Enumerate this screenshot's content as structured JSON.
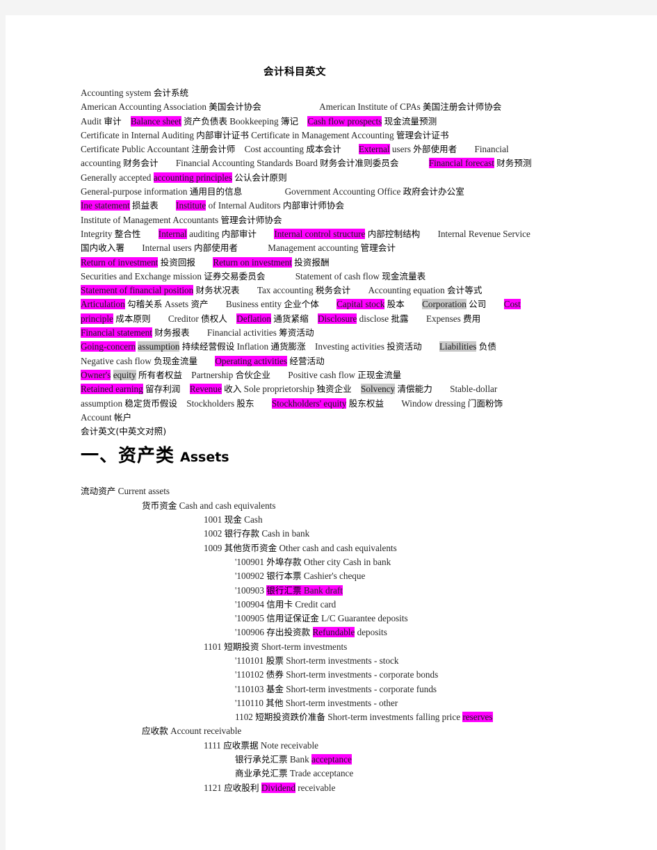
{
  "document": {
    "title": "会计科目英文",
    "subtitle_line": "会计英文(中英文对照)",
    "section_heading": {
      "cn": "一、资产类",
      "en": "Assets"
    }
  },
  "glossary_lines": [
    {
      "id": "line-1",
      "parts": [
        {
          "t": "Accounting  system",
          "k": "en"
        },
        {
          "t": "会计系统",
          "k": "cn"
        }
      ]
    },
    {
      "id": "line-2",
      "parts": [
        {
          "t": "American  Accounting  Association",
          "k": "en"
        },
        {
          "t": "美国会计协会",
          "k": "cn"
        },
        {
          "t": "__sp5__",
          "k": "sp"
        },
        {
          "t": "American  Institute  of  CPAs",
          "k": "en"
        },
        {
          "t": "美国注册会计师协会",
          "k": "cn"
        }
      ]
    },
    {
      "id": "line-3",
      "parts": [
        {
          "t": "Audit",
          "k": "en"
        },
        {
          "t": "审计",
          "k": "cn"
        },
        {
          "t": "__sp1__",
          "k": "sp"
        },
        {
          "t": "Balance  sheet",
          "k": "en",
          "hl": "pink"
        },
        {
          "t": "资产负债表",
          "k": "cn"
        },
        {
          "t": "Bookkeeping",
          "k": "en"
        },
        {
          "t": "簿记",
          "k": "cn"
        },
        {
          "t": "__sp1__",
          "k": "sp"
        },
        {
          "t": "Cash  flow  prospects",
          "k": "en",
          "hl": "pink"
        },
        {
          "t": "现金流量预测",
          "k": "cn"
        }
      ]
    },
    {
      "id": "line-4",
      "parts": [
        {
          "t": "Certificate  in  Internal  Auditing",
          "k": "en"
        },
        {
          "t": "内部审计证书",
          "k": "cn"
        },
        {
          "t": "Certificate  in  Management  Accounting",
          "k": "en"
        },
        {
          "t": "管理会计证书",
          "k": "cn"
        }
      ]
    },
    {
      "id": "line-5",
      "parts": [
        {
          "t": "Certificate  Public  Accountant",
          "k": "en"
        },
        {
          "t": "注册会计师",
          "k": "cn"
        },
        {
          "t": "__sp1__",
          "k": "sp"
        },
        {
          "t": "Cost  accounting",
          "k": "en"
        },
        {
          "t": "成本会计",
          "k": "cn"
        },
        {
          "t": "__sp2__",
          "k": "sp"
        },
        {
          "t": "External",
          "k": "en",
          "hl": "pink"
        },
        {
          "t": "users",
          "k": "en"
        },
        {
          "t": "外部使用者",
          "k": "cn"
        },
        {
          "t": "__sp2__",
          "k": "sp"
        },
        {
          "t": "Financial",
          "k": "en"
        }
      ]
    },
    {
      "id": "line-6",
      "parts": [
        {
          "t": "accounting",
          "k": "en"
        },
        {
          "t": "财务会计",
          "k": "cn"
        },
        {
          "t": "__sp2__",
          "k": "sp"
        },
        {
          "t": "Financial  Accounting  Standards  Board",
          "k": "en"
        },
        {
          "t": "财务会计准则委员会",
          "k": "cn"
        },
        {
          "t": "__sp3__",
          "k": "sp"
        },
        {
          "t": "Financial  forecast",
          "k": "en",
          "hl": "pink"
        },
        {
          "t": "财务预测",
          "k": "cn"
        }
      ]
    },
    {
      "id": "line-7",
      "parts": [
        {
          "t": "Generally  accepted",
          "k": "en"
        },
        {
          "t": "accounting  principles",
          "k": "en",
          "hl": "pink"
        },
        {
          "t": "公认会计原则",
          "k": "cn"
        }
      ]
    },
    {
      "id": "line-8",
      "parts": [
        {
          "t": "General-purpose  information",
          "k": "en"
        },
        {
          "t": "通用目的信息",
          "k": "cn"
        },
        {
          "t": "__sp4__",
          "k": "sp"
        },
        {
          "t": "Government  Accounting  Office",
          "k": "en"
        },
        {
          "t": "政府会计办公室",
          "k": "cn"
        }
      ]
    },
    {
      "id": "line-9",
      "parts": [
        {
          "t": "Ine  statement",
          "k": "en",
          "hl": "pink"
        },
        {
          "t": "损益表",
          "k": "cn"
        },
        {
          "t": "__sp2__",
          "k": "sp"
        },
        {
          "t": "Institute",
          "k": "en",
          "hl": "pink"
        },
        {
          "t": "of  Internal  Auditors",
          "k": "en"
        },
        {
          "t": "内部审计师协会",
          "k": "cn"
        }
      ]
    },
    {
      "id": "line-10",
      "parts": [
        {
          "t": "Institute  of  Management  Accountants",
          "k": "en"
        },
        {
          "t": "管理会计师协会",
          "k": "cn"
        }
      ]
    },
    {
      "id": "line-11",
      "parts": [
        {
          "t": "Integrity",
          "k": "en"
        },
        {
          "t": "整合性",
          "k": "cn"
        },
        {
          "t": "__sp2__",
          "k": "sp"
        },
        {
          "t": "Internal",
          "k": "en",
          "hl": "pink"
        },
        {
          "t": "auditing",
          "k": "en"
        },
        {
          "t": "内部审计",
          "k": "cn"
        },
        {
          "t": "__sp2__",
          "k": "sp"
        },
        {
          "t": "Internal  control  structure",
          "k": "en",
          "hl": "pink"
        },
        {
          "t": "内部控制结构",
          "k": "cn"
        },
        {
          "t": "__sp2__",
          "k": "sp"
        },
        {
          "t": "Internal  Revenue  Service",
          "k": "en"
        }
      ]
    },
    {
      "id": "line-12",
      "parts": [
        {
          "t": "国内收入署",
          "k": "cn"
        },
        {
          "t": "__sp2__",
          "k": "sp"
        },
        {
          "t": "Internal  users",
          "k": "en"
        },
        {
          "t": "内部使用者",
          "k": "cn"
        },
        {
          "t": "__sp3__",
          "k": "sp"
        },
        {
          "t": "Management  accounting",
          "k": "en"
        },
        {
          "t": "管理会计",
          "k": "cn"
        }
      ]
    },
    {
      "id": "line-13",
      "parts": [
        {
          "t": "Return  of  investment",
          "k": "en",
          "hl": "pink"
        },
        {
          "t": "投资回报",
          "k": "cn"
        },
        {
          "t": "__sp2__",
          "k": "sp"
        },
        {
          "t": "Return  on  investment",
          "k": "en",
          "hl": "pink"
        },
        {
          "t": "投资报酬",
          "k": "cn"
        }
      ]
    },
    {
      "id": "line-14",
      "parts": [
        {
          "t": "Securities  and  Exchange  mission",
          "k": "en"
        },
        {
          "t": "证券交易委员会",
          "k": "cn"
        },
        {
          "t": "__sp3__",
          "k": "sp"
        },
        {
          "t": "Statement  of  cash  flow",
          "k": "en"
        },
        {
          "t": "现金流量表",
          "k": "cn"
        }
      ]
    },
    {
      "id": "line-15",
      "parts": [
        {
          "t": "Statement  of  financial  position",
          "k": "en",
          "hl": "pink"
        },
        {
          "t": "财务状况表",
          "k": "cn"
        },
        {
          "t": "__sp2__",
          "k": "sp"
        },
        {
          "t": "Tax  accounting",
          "k": "en"
        },
        {
          "t": "税务会计",
          "k": "cn"
        },
        {
          "t": "__sp2__",
          "k": "sp"
        },
        {
          "t": "Accounting  equation",
          "k": "en"
        },
        {
          "t": "会计等式",
          "k": "cn"
        }
      ]
    },
    {
      "id": "line-16",
      "parts": [
        {
          "t": "Articulation",
          "k": "en",
          "hl": "pink"
        },
        {
          "t": "勾稽关系",
          "k": "cn"
        },
        {
          "t": "Assets",
          "k": "en"
        },
        {
          "t": "资产",
          "k": "cn"
        },
        {
          "t": "__sp2__",
          "k": "sp"
        },
        {
          "t": "Business  entity",
          "k": "en"
        },
        {
          "t": "企业个体",
          "k": "cn"
        },
        {
          "t": "__sp2__",
          "k": "sp"
        },
        {
          "t": "Capital  stock",
          "k": "en",
          "hl": "pink"
        },
        {
          "t": "股本",
          "k": "cn"
        },
        {
          "t": "__sp2__",
          "k": "sp"
        },
        {
          "t": "Corporation",
          "k": "en",
          "hl": "gray"
        },
        {
          "t": "公司",
          "k": "cn"
        },
        {
          "t": "__sp2__",
          "k": "sp"
        },
        {
          "t": "Cost",
          "k": "en",
          "hl": "pink"
        }
      ]
    },
    {
      "id": "line-17",
      "parts": [
        {
          "t": "principle",
          "k": "en",
          "hl": "pink"
        },
        {
          "t": "成本原则",
          "k": "cn"
        },
        {
          "t": "__sp2__",
          "k": "sp"
        },
        {
          "t": "Creditor",
          "k": "en"
        },
        {
          "t": "债权人",
          "k": "cn"
        },
        {
          "t": "__sp1__",
          "k": "sp"
        },
        {
          "t": "Deflation",
          "k": "en",
          "hl": "pink"
        },
        {
          "t": "通货紧缩",
          "k": "cn"
        },
        {
          "t": "__sp1__",
          "k": "sp"
        },
        {
          "t": "Disclosure",
          "k": "en",
          "hl": "pink"
        },
        {
          "t": "disclose",
          "k": "en"
        },
        {
          "t": "批露",
          "k": "cn"
        },
        {
          "t": "__sp2__",
          "k": "sp"
        },
        {
          "t": "Expenses",
          "k": "en"
        },
        {
          "t": "费用",
          "k": "cn"
        }
      ]
    },
    {
      "id": "line-18",
      "parts": [
        {
          "t": "Financial  statement",
          "k": "en",
          "hl": "pink"
        },
        {
          "t": "财务报表",
          "k": "cn"
        },
        {
          "t": "__sp2__",
          "k": "sp"
        },
        {
          "t": "Financial  activities",
          "k": "en"
        },
        {
          "t": "筹资活动",
          "k": "cn"
        }
      ]
    },
    {
      "id": "line-19",
      "parts": [
        {
          "t": "Going-concern",
          "k": "en",
          "hl": "pink"
        },
        {
          "t": "assumption",
          "k": "en",
          "hl": "gray"
        },
        {
          "t": "持续经营假设",
          "k": "cn"
        },
        {
          "t": "Inflation",
          "k": "en"
        },
        {
          "t": "通货膨涨",
          "k": "cn"
        },
        {
          "t": "__sp1__",
          "k": "sp"
        },
        {
          "t": "Investing  activities",
          "k": "en"
        },
        {
          "t": "投资活动",
          "k": "cn"
        },
        {
          "t": "__sp2__",
          "k": "sp"
        },
        {
          "t": "Liabilities",
          "k": "en",
          "hl": "gray"
        },
        {
          "t": "负债",
          "k": "cn"
        }
      ]
    },
    {
      "id": "line-20",
      "parts": [
        {
          "t": "Negative  cash  flow",
          "k": "en"
        },
        {
          "t": "负现金流量",
          "k": "cn"
        },
        {
          "t": "__sp2__",
          "k": "sp"
        },
        {
          "t": "Operating  activities",
          "k": "en",
          "hl": "pink"
        },
        {
          "t": "经营活动",
          "k": "cn"
        }
      ]
    },
    {
      "id": "line-21",
      "parts": [
        {
          "t": "Owner's",
          "k": "en",
          "hl": "pink"
        },
        {
          "t": "equity",
          "k": "en",
          "hl": "gray"
        },
        {
          "t": "所有者权益",
          "k": "cn"
        },
        {
          "t": "__sp1__",
          "k": "sp"
        },
        {
          "t": "Partnership",
          "k": "en"
        },
        {
          "t": "合伙企业",
          "k": "cn"
        },
        {
          "t": "__sp2__",
          "k": "sp"
        },
        {
          "t": "Positive  cash  flow",
          "k": "en"
        },
        {
          "t": "正现金流量",
          "k": "cn"
        }
      ]
    },
    {
      "id": "line-22",
      "parts": [
        {
          "t": "Retained  earning",
          "k": "en",
          "hl": "pink"
        },
        {
          "t": "留存利润",
          "k": "cn"
        },
        {
          "t": "__sp1__",
          "k": "sp"
        },
        {
          "t": "Revenue",
          "k": "en",
          "hl": "pink"
        },
        {
          "t": "收入",
          "k": "cn"
        },
        {
          "t": "Sole  proprietorship",
          "k": "en"
        },
        {
          "t": "独资企业",
          "k": "cn"
        },
        {
          "t": "__sp1__",
          "k": "sp"
        },
        {
          "t": "Solvency",
          "k": "en",
          "hl": "gray"
        },
        {
          "t": "清偿能力",
          "k": "cn"
        },
        {
          "t": "__sp2__",
          "k": "sp"
        },
        {
          "t": "Stable-dollar",
          "k": "en"
        }
      ]
    },
    {
      "id": "line-23",
      "parts": [
        {
          "t": "assumption",
          "k": "en"
        },
        {
          "t": "稳定货币假设",
          "k": "cn"
        },
        {
          "t": "__sp1__",
          "k": "sp"
        },
        {
          "t": "Stockholders",
          "k": "en"
        },
        {
          "t": "股东",
          "k": "cn"
        },
        {
          "t": "__sp2__",
          "k": "sp"
        },
        {
          "t": "Stockholders'  equity",
          "k": "en",
          "hl": "pink"
        },
        {
          "t": "股东权益",
          "k": "cn"
        },
        {
          "t": "__sp2__",
          "k": "sp"
        },
        {
          "t": "Window  dressing",
          "k": "en"
        },
        {
          "t": "门面粉饰",
          "k": "cn"
        }
      ]
    },
    {
      "id": "line-24",
      "parts": [
        {
          "t": "Account",
          "k": "en"
        },
        {
          "t": "帐户",
          "k": "cn"
        }
      ]
    },
    {
      "id": "line-25",
      "parts": [
        {
          "t": "会计英文(中英文对照)",
          "k": "cn"
        }
      ]
    }
  ],
  "accounts": [
    {
      "indent": 0,
      "code": "",
      "cn": "流动资产",
      "en": "Current  assets"
    },
    {
      "indent": 1,
      "code": "",
      "cn": "货币资金",
      "en": "Cash  and  cash  equivalents"
    },
    {
      "indent": 2,
      "code": "1001",
      "cn": "现金",
      "en": "Cash"
    },
    {
      "indent": 2,
      "code": "1002",
      "cn": "银行存款",
      "en": "Cash  in  bank"
    },
    {
      "indent": 2,
      "code": "1009",
      "cn": "其他货币资金",
      "en": "Other  cash  and  cash  equivalents"
    },
    {
      "indent": 3,
      "code": "'100901",
      "cn": "外埠存款",
      "en": "Other  city  Cash  in  bank"
    },
    {
      "indent": 3,
      "code": "'100902",
      "cn": "银行本票",
      "en": "Cashier's  cheque"
    },
    {
      "indent": 3,
      "code": "'100903",
      "cn": "银行汇票",
      "en": "Bank  draft",
      "hl": "pink",
      "hl_cn": true
    },
    {
      "indent": 3,
      "code": "'100904",
      "cn": "信用卡",
      "en": "Credit  card"
    },
    {
      "indent": 3,
      "code": "'100905",
      "cn": "信用证保证金",
      "en": "L/C  Guarantee  deposits"
    },
    {
      "indent": 3,
      "code": "'100906",
      "cn": "存出投资款",
      "en": "Refundable",
      "en_tail": "deposits",
      "hl": "pink"
    },
    {
      "indent": 2,
      "code": "1101",
      "cn": "短期投资",
      "en": "Short-term  investments"
    },
    {
      "indent": 3,
      "code": "'110101",
      "cn": "股票",
      "en": "Short-term  investments  -  stock"
    },
    {
      "indent": 3,
      "code": "'110102",
      "cn": "债券",
      "en": "Short-term  investments  -  corporate  bonds"
    },
    {
      "indent": 3,
      "code": "'110103",
      "cn": "基金",
      "en": "Short-term  investments  -  corporate  funds"
    },
    {
      "indent": 3,
      "code": "'110110",
      "cn": "其他",
      "en": "Short-term  investments  -  other"
    },
    {
      "indent": 3,
      "code": "1102",
      "cn": "短期投资跌价准备",
      "en": "Short-term  investments  falling  price",
      "en_hl_tail": "reserves"
    },
    {
      "indent": 1,
      "code": "",
      "cn": "应收款",
      "en": "Account  receivable"
    },
    {
      "indent": 2,
      "code": "1111",
      "cn": "应收票据",
      "en": "Note  receivable"
    },
    {
      "indent": 3,
      "code": "",
      "cn": "银行承兑汇票",
      "en": "Bank",
      "en_hl_tail": "acceptance"
    },
    {
      "indent": 3,
      "code": "",
      "cn": "商业承兑汇票",
      "en": "Trade  acceptance"
    },
    {
      "indent": 2,
      "code": "1121",
      "cn": "应收股利",
      "en": "Dividend",
      "en_tail": "receivable",
      "hl": "pink"
    }
  ],
  "colors": {
    "highlight_pink": "#ff00ff",
    "highlight_gray": "#c8c8c8",
    "page_background": "#ffffff",
    "canvas_background": "#f4f4f4",
    "text": "#1a1a1a"
  }
}
